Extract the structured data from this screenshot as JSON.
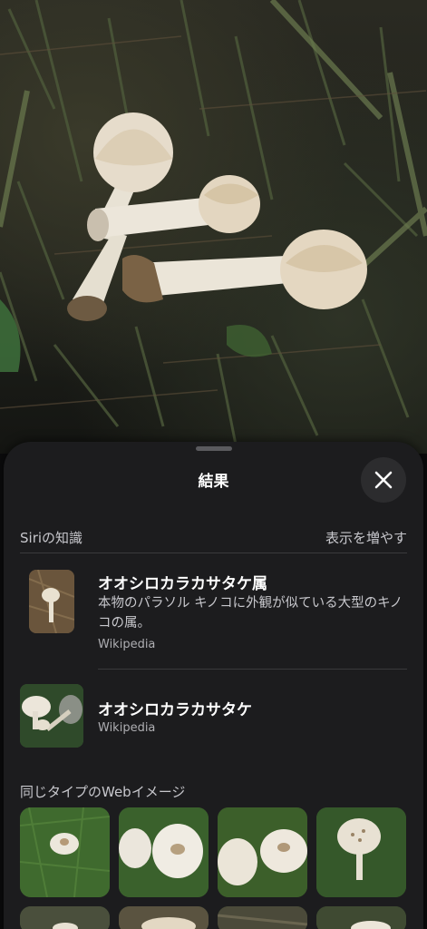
{
  "sheet": {
    "title": "結果",
    "close_icon": "close-icon"
  },
  "siri_knowledge": {
    "label": "Siriの知識",
    "show_more": "表示を増やす",
    "results": [
      {
        "title": "オオシロカラカサタケ属",
        "description": "本物のパラソル キノコに外観が似ている大型のキノコの属。",
        "source": "Wikipedia"
      },
      {
        "title": "オオシロカラカサタケ",
        "source": "Wikipedia"
      }
    ]
  },
  "web_images": {
    "label": "同じタイプのWebイメージ",
    "count_visible": 8
  },
  "colors": {
    "sheet_bg": "#1c1c1e",
    "text_primary": "#ffffff",
    "text_secondary": "#c7c7cc",
    "grass": "#3b5a2b"
  }
}
